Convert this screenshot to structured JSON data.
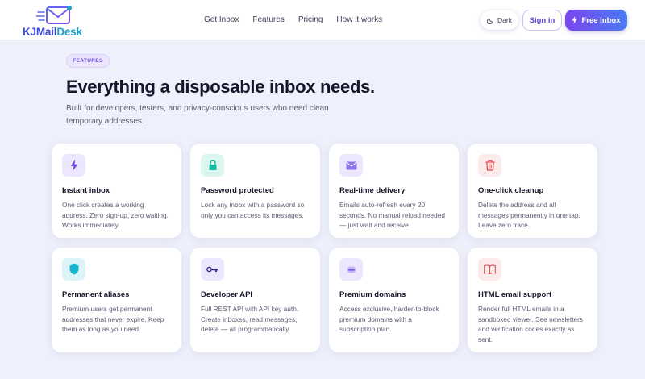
{
  "brand": {
    "part1": "KJ",
    "part2": "Mail",
    "part3": "Desk"
  },
  "nav": {
    "links": [
      "Get Inbox",
      "Features",
      "Pricing",
      "How it works"
    ],
    "dark_label": "Dark",
    "signin_label": "Sign in",
    "free_inbox_label": "Free Inbox"
  },
  "hero": {
    "badge": "FEATURES",
    "title": "Everything a disposable inbox needs.",
    "subtitle": "Built for developers, testers, and privacy-conscious users who need clean temporary addresses."
  },
  "features": [
    {
      "icon": "lightning-icon",
      "color": "#6a3fe0",
      "bg": "#ece7fd",
      "title": "Instant inbox",
      "desc": "One click creates a working address. Zero sign-up, zero waiting. Works immediately."
    },
    {
      "icon": "lock-icon",
      "color": "#10b9a0",
      "bg": "#dcf6f1",
      "title": "Password protected",
      "desc": "Lock any inbox with a password so only you can access its messages."
    },
    {
      "icon": "envelope-icon",
      "color": "#7b5ce8",
      "bg": "#ece7fd",
      "title": "Real-time delivery",
      "desc": "Emails auto-refresh every 20 seconds. No manual reload needed — just wait and receive."
    },
    {
      "icon": "trash-icon",
      "color": "#e0484b",
      "bg": "#fdebeb",
      "title": "One-click cleanup",
      "desc": "Delete the address and all messages permanently in one tap. Leave zero trace."
    },
    {
      "icon": "shield-icon",
      "color": "#16b4cf",
      "bg": "#ddf4f8",
      "title": "Permanent aliases",
      "desc": "Premium users get permanent addresses that never expire. Keep them as long as you need."
    },
    {
      "icon": "key-icon",
      "color": "#3b2e8a",
      "bg": "#ece7fd",
      "title": "Developer API",
      "desc": "Full REST API with API key auth. Create inboxes, read messages, delete — all programmatically."
    },
    {
      "icon": "diamond-icon",
      "color": "#7b5ce8",
      "bg": "#ece7fd",
      "title": "Premium domains",
      "desc": "Access exclusive, harder-to-block premium domains with a subscription plan."
    },
    {
      "icon": "book-icon",
      "color": "#e0484b",
      "bg": "#fdebeb",
      "title": "HTML email support",
      "desc": "Render full HTML emails in a sandboxed viewer. See newsletters and verification codes exactly as sent."
    }
  ]
}
